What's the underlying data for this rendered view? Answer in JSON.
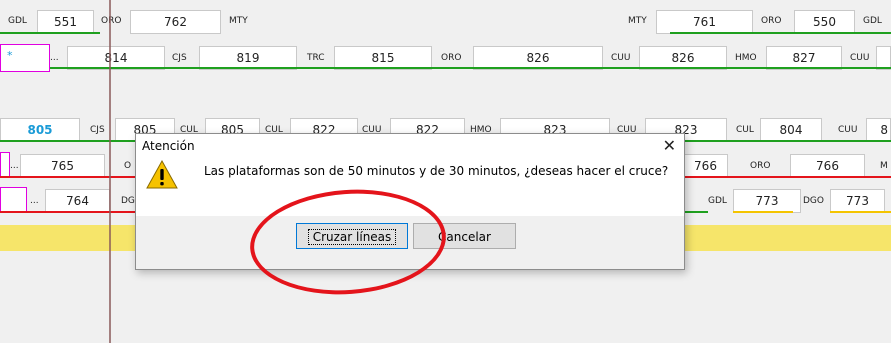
{
  "colors": {
    "green": "#1fa01f",
    "red": "#e4141b",
    "yellow": "#f4c400",
    "magenta": "#e000e0",
    "blue": "#1a9bd7"
  },
  "row1": {
    "left_codes": [
      "GDL",
      "ORO",
      "MTY"
    ],
    "left_nums": [
      "551",
      "762"
    ],
    "right_codes": [
      "MTY",
      "ORO",
      "GDL"
    ],
    "right_nums": [
      "761",
      "550"
    ]
  },
  "row2": {
    "marker": "*",
    "ellipsis": "...",
    "codes": [
      "CJS",
      "TRC",
      "ORO",
      "CUU",
      "HMO",
      "CUU"
    ],
    "nums": [
      "814",
      "819",
      "815",
      "826",
      "826",
      "827"
    ]
  },
  "row3": {
    "codes": [
      "CJS",
      "CUL",
      "CUL",
      "CUU",
      "HMO",
      "CUU",
      "CUL",
      "CUU"
    ],
    "nums": [
      "805",
      "805",
      "805",
      "822",
      "822",
      "823",
      "823",
      "804",
      "8"
    ]
  },
  "row4": {
    "ellipsis": "...",
    "codes": [
      "O",
      "ORO",
      "M"
    ],
    "nums": [
      "765",
      "766",
      "766"
    ]
  },
  "row5": {
    "ellipsis": "...",
    "codes": [
      "DG",
      "GDL",
      "DGO"
    ],
    "nums": [
      "764",
      "773",
      "773"
    ]
  },
  "dialog": {
    "title": "Atención",
    "close": "✕",
    "message": "Las plataformas son de 50 minutos y de 30 minutos, ¿deseas hacer el cruce?",
    "confirm": "Cruzar líneas",
    "cancel": "Cancelar"
  }
}
